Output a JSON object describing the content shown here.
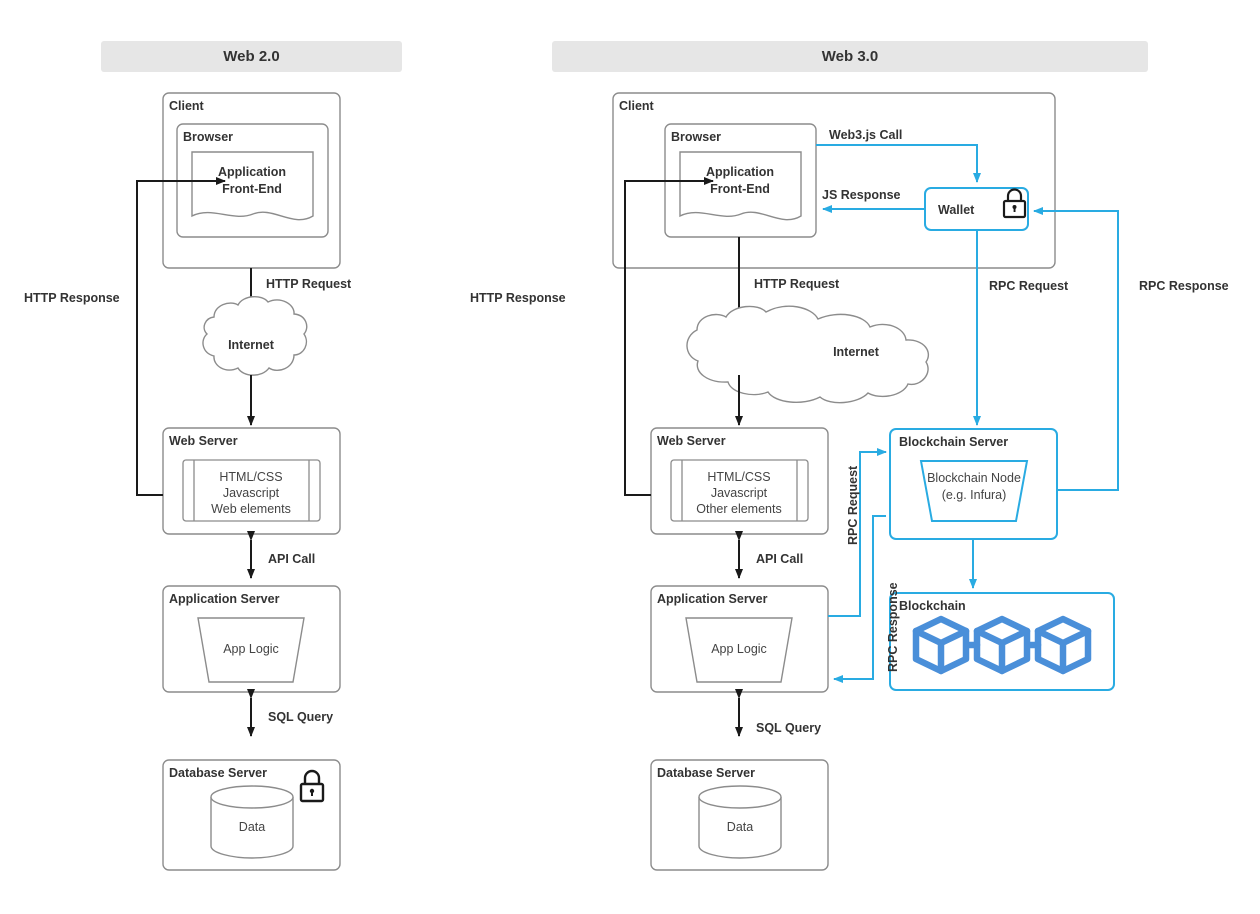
{
  "diagram": {
    "title_left": "Web 2.0",
    "title_right": "Web 3.0"
  },
  "web2": {
    "client": "Client",
    "browser": "Browser",
    "frontend_line1": "Application",
    "frontend_line2": "Front-End",
    "http_request": "HTTP Request",
    "http_response": "HTTP Response",
    "internet": "Internet",
    "web_server": "Web Server",
    "web_assets_line1": "HTML/CSS",
    "web_assets_line2": "Javascript",
    "web_assets_line3": "Web elements",
    "api_call": "API Call",
    "app_server": "Application Server",
    "app_logic": "App Logic",
    "sql_query": "SQL Query",
    "db_server": "Database Server",
    "data": "Data",
    "lock_icon": "lock-icon"
  },
  "web3": {
    "client": "Client",
    "browser": "Browser",
    "frontend_line1": "Application",
    "frontend_line2": "Front-End",
    "web3js_call": "Web3.js Call",
    "js_response": "JS Response",
    "wallet": "Wallet",
    "wallet_lock_icon": "lock-icon",
    "http_request": "HTTP Request",
    "http_response": "HTTP Response",
    "rpc_request_top": "RPC Request",
    "rpc_response_top": "RPC Response",
    "internet": "Internet",
    "web_server": "Web Server",
    "web_assets_line1": "HTML/CSS",
    "web_assets_line2": "Javascript",
    "web_assets_line3": "Other elements",
    "api_call": "API Call",
    "app_server": "Application Server",
    "app_logic": "App Logic",
    "sql_query": "SQL Query",
    "db_server": "Database Server",
    "data": "Data",
    "rpc_request_mid": "RPC Request",
    "rpc_response_mid": "RPC Response",
    "blockchain_server": "Blockchain Server",
    "blockchain_node_line1": "Blockchain Node",
    "blockchain_node_line2": "(e.g. Infura)",
    "blockchain": "Blockchain",
    "blockchain_cubes_icon": "blockchain-cubes-icon"
  },
  "colors": {
    "accent_blue": "#29abe2",
    "cube_blue": "#4a8fd9",
    "stroke_gray": "#8c8c8c",
    "stroke_black": "#1a1a1a",
    "header_bg": "#e6e6e6",
    "text": "#333333"
  }
}
